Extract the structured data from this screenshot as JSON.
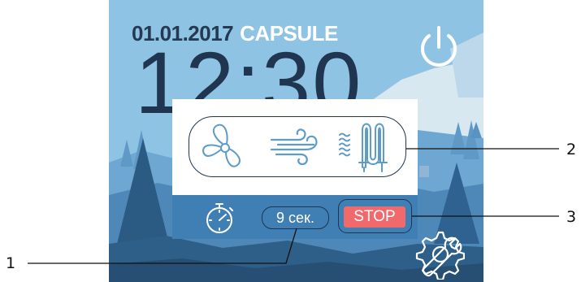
{
  "screen": {
    "date": "01.01.2017",
    "brand": "CAPSULE",
    "time": "12:30",
    "icons": {
      "power": "power-icon",
      "fan": "fan-icon",
      "wind": "wind-icon",
      "heater": "heating-element-icon",
      "timer": "stopwatch-icon",
      "settings": "settings-gear-wrench-icon"
    },
    "timer_value": "9 сек.",
    "stop_label": "STOP"
  },
  "callouts": {
    "c1": "1",
    "c2": "2",
    "c3": "3"
  },
  "colors": {
    "sky": "#8fc3e3",
    "dark_text": "#1f3550",
    "stop_button": "#f06a6d",
    "bottom_bar": "#3f7fb4",
    "icon_stroke": "#5d9bc9"
  }
}
